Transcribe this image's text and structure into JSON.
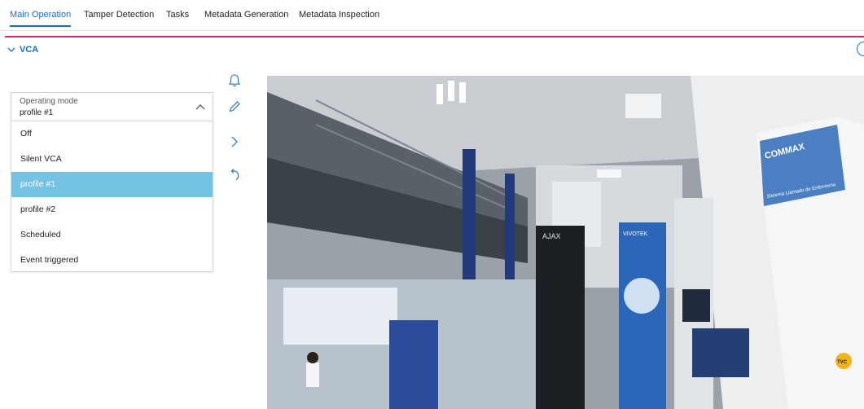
{
  "tabs": [
    {
      "label": "Main Operation",
      "active": true
    },
    {
      "label": "Tamper Detection",
      "active": false
    },
    {
      "label": "Tasks",
      "active": false
    },
    {
      "label": "Metadata Generation",
      "active": false
    },
    {
      "label": "Metadata Inspection",
      "active": false
    }
  ],
  "section": {
    "title": "VCA"
  },
  "operating_mode": {
    "label": "Operating mode",
    "value": "profile #1",
    "options": [
      {
        "label": "Off",
        "selected": false
      },
      {
        "label": "Silent VCA",
        "selected": false
      },
      {
        "label": "profile #1",
        "selected": true
      },
      {
        "label": "profile #2",
        "selected": false
      },
      {
        "label": "Scheduled",
        "selected": false
      },
      {
        "label": "Event triggered",
        "selected": false
      }
    ]
  },
  "toolbar_icons": [
    "bell-icon",
    "pencil-icon",
    "chevron-right-icon",
    "undo-icon"
  ],
  "colors": {
    "accent": "#1a6fbd",
    "divider": "#c8286e",
    "selected_option": "#74c3e4"
  },
  "video": {
    "signs": {
      "left_brand": "AJAX",
      "center_brand": "VIVOTEK",
      "right_brand": "COMMAX",
      "right_subtitle": "Sistema Llamado de Enfermeria",
      "corner_badge": "TVC"
    }
  }
}
